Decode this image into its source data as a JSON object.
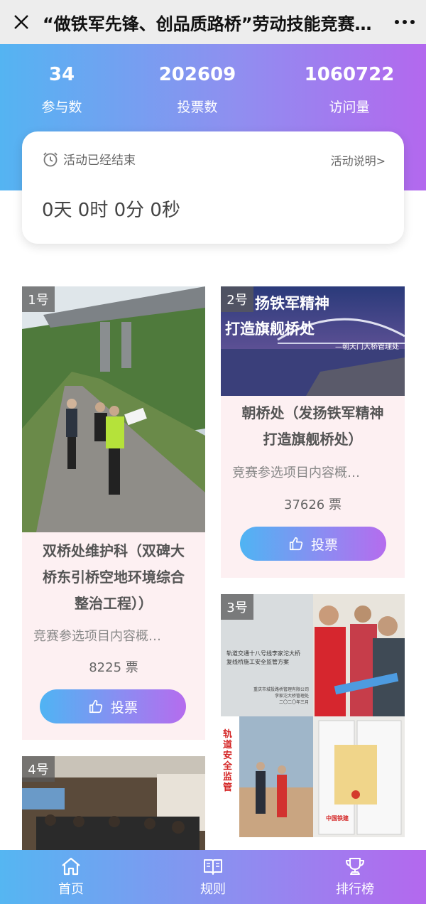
{
  "topbar": {
    "title": "“做铁军先锋、创品质路桥”劳动技能竞赛…",
    "close_icon": "close-icon",
    "more_icon": "more-icon"
  },
  "stats": [
    {
      "value": "34",
      "label": "参与数"
    },
    {
      "value": "202609",
      "label": "投票数"
    },
    {
      "value": "1060722",
      "label": "访问量"
    }
  ],
  "countdown": {
    "status": "活动已经结束",
    "explain_link": "活动说明>",
    "time": "0天 0时 0分 0秒"
  },
  "entries": [
    {
      "badge": "1号",
      "title_lines": [
        "双桥处维护科（双碑大",
        "桥东引桥空地环境综合",
        "整治工程））"
      ],
      "desc": "竞赛参选项目内容概…",
      "votes": "8225 票",
      "vote_label": "投票"
    },
    {
      "badge": "2号",
      "image_text_line1": "扬铁军精神",
      "image_text_line2": "打造旗舰桥处",
      "image_caption": "—朝天门大桥管理处",
      "title_lines": [
        "朝桥处（发扬铁军精神",
        "打造旗舰桥处）"
      ],
      "desc": "竞赛参选项目内容概…",
      "votes": "37626 票",
      "vote_label": "投票"
    },
    {
      "badge": "3号",
      "doc_line1": "轨道交通十八号线李家沱大桥",
      "doc_line2": "复线桥施工安全监管方案",
      "doc_line3": "重庆市城投路桥管理有限公司",
      "doc_line4": "李家沱大桥管理处",
      "doc_line5": "二〇二〇年三月",
      "side_text": "轨道安全监管",
      "stamp_text": "中国铁建"
    },
    {
      "badge": "4号"
    }
  ],
  "bottom_nav": [
    {
      "label": "首页",
      "icon": "home-icon"
    },
    {
      "label": "规则",
      "icon": "book-icon"
    },
    {
      "label": "排行榜",
      "icon": "trophy-icon"
    }
  ],
  "colors": {
    "gradient_start": "#54b4f2",
    "gradient_end": "#b368ee",
    "card_bg": "#fdf0f2"
  }
}
